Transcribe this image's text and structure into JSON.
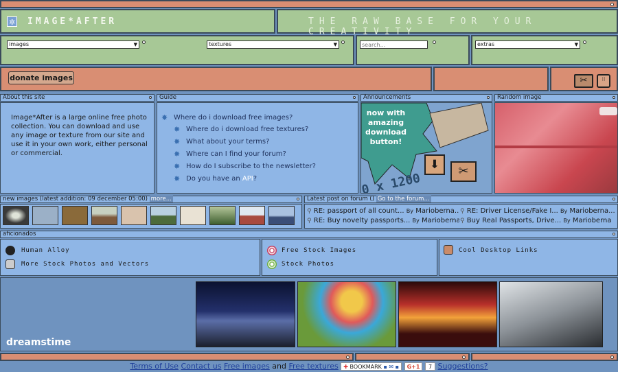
{
  "header": {
    "logo_text": "IMAGE*AFTER",
    "tagline": "THE RAW BASE FOR YOUR CREATIVITY"
  },
  "nav": {
    "images_select": "images",
    "textures_select": "textures",
    "search_placeholder": "search...",
    "extras_select": "extras"
  },
  "donate": {
    "label": "donate images"
  },
  "about": {
    "title": "About this site",
    "text": "Image*After is a large online free photo collection. You can download and use any image or texture from our site and use it in your own work, either personal or commercial."
  },
  "guide": {
    "title": "Guide",
    "items": [
      "Where do i download free images?",
      "Where do i download free textures?",
      "What about your terms?",
      "Where can I find your forum?",
      "How do I subscribe to the newsletter?"
    ],
    "api_prefix": "Do you have an ",
    "api_link": "API",
    "api_suffix": "?"
  },
  "announcements": {
    "title": "Announcements",
    "banner_text": "now with amazing download button!",
    "banner_sub": "0 x 1200"
  },
  "random": {
    "title": "Random image"
  },
  "new_images": {
    "title": "new images (latest addition: 09 december 05:00)",
    "more_link": "more..."
  },
  "forum": {
    "title": "Latest post on forum ()",
    "go_link": "Go to the forum...",
    "posts": [
      {
        "title": "RE: passport of all count...",
        "by": "By",
        "author": "Mariobernа..."
      },
      {
        "title": "RE: Driver License/Fake I...",
        "by": "By",
        "author": "Mariobernа..."
      },
      {
        "title": "RE: Buy novelty passports...",
        "by": "By",
        "author": "Mariobernа"
      },
      {
        "title": "Buy Real Passports, Drive...",
        "by": "By",
        "author": "Mariobernа"
      }
    ]
  },
  "aficionados": {
    "title": "aficionados",
    "links": [
      "Human Alloy",
      "More Stock Photos and Vectors",
      "Free Stock Images",
      "Stock Photos",
      "Cool Desktop Links"
    ]
  },
  "dreamstime": {
    "logo": "dreamstime"
  },
  "footer": {
    "terms": "Terms of Use",
    "contact": "Contact us",
    "free_images": "Free images",
    "and": "and",
    "free_textures": "Free textures",
    "bookmark": "BOOKMARK",
    "gplus": "G+1",
    "gplus_count": "7",
    "suggestions": "Suggestions?"
  },
  "colors": {
    "salmon": "#d98e73",
    "green": "#a7c896",
    "blue": "#8fb6e6",
    "background": "#6f93bf"
  }
}
